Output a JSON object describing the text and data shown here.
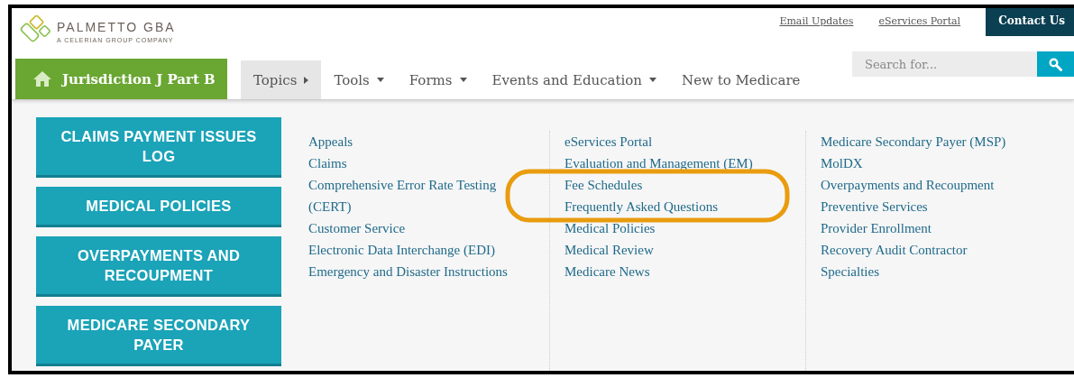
{
  "logo": {
    "name": "PALMETTO GBA",
    "tagline": "A CELERIAN GROUP COMPANY"
  },
  "top_links": [
    {
      "label": "Email Updates",
      "kind": "link"
    },
    {
      "label": "eServices Portal",
      "kind": "link"
    },
    {
      "label": "Contact Us",
      "kind": "button"
    }
  ],
  "jurisdiction": "Jurisdiction J Part B",
  "nav": [
    {
      "label": "Topics",
      "selected": true,
      "dropdown": false
    },
    {
      "label": "Tools",
      "selected": false,
      "dropdown": true
    },
    {
      "label": "Forms",
      "selected": false,
      "dropdown": true
    },
    {
      "label": "Events and Education",
      "selected": false,
      "dropdown": true
    },
    {
      "label": "New to Medicare",
      "selected": false,
      "dropdown": false
    }
  ],
  "search": {
    "placeholder": "Search for..."
  },
  "quick_buttons": [
    "CLAIMS PAYMENT ISSUES LOG",
    "MEDICAL POLICIES",
    "OVERPAYMENTS AND RECOUPMENT",
    "MEDICARE SECONDARY PAYER"
  ],
  "topic_columns": [
    [
      {
        "label": "Appeals",
        "highlighted": false
      },
      {
        "label": "Claims",
        "highlighted": false
      },
      {
        "label": "Comprehensive Error Rate Testing (CERT)",
        "highlighted": false
      },
      {
        "label": "Customer Service",
        "highlighted": false
      },
      {
        "label": "Electronic Data Interchange (EDI)",
        "highlighted": false
      },
      {
        "label": "Emergency and Disaster Instructions",
        "highlighted": false
      }
    ],
    [
      {
        "label": "eServices Portal",
        "highlighted": false
      },
      {
        "label": "Evaluation and Management (EM)",
        "highlighted": false
      },
      {
        "label": "Fee Schedules",
        "highlighted": true
      },
      {
        "label": "Frequently Asked Questions",
        "highlighted": true
      },
      {
        "label": "Medical Policies",
        "highlighted": false
      },
      {
        "label": "Medical Review",
        "highlighted": false
      },
      {
        "label": "Medicare News",
        "highlighted": false
      }
    ],
    [
      {
        "label": "Medicare Secondary Payer (MSP)",
        "highlighted": false
      },
      {
        "label": "MolDX",
        "highlighted": false
      },
      {
        "label": "Overpayments and Recoupment",
        "highlighted": false
      },
      {
        "label": "Preventive Services",
        "highlighted": false
      },
      {
        "label": "Provider Enrollment",
        "highlighted": false
      },
      {
        "label": "Recovery Audit Contractor",
        "highlighted": false
      },
      {
        "label": "Specialties",
        "highlighted": false
      }
    ]
  ],
  "highlight": {
    "color": "#e89c0e"
  }
}
